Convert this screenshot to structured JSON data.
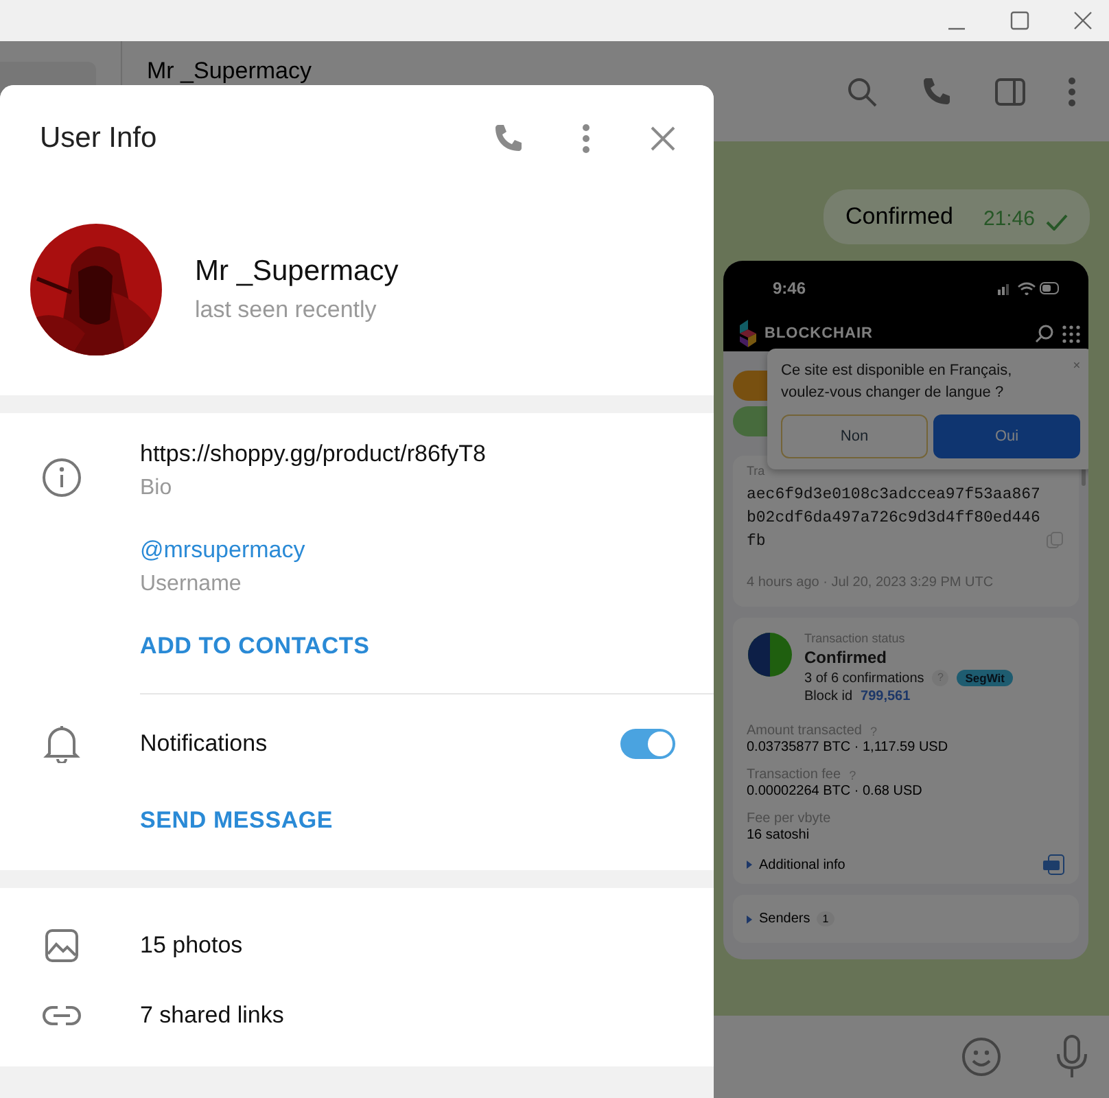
{
  "chat_header": {
    "title": "Mr _Supermacy"
  },
  "messages": [
    {
      "kind": "text",
      "text": "Confirmed",
      "time": "21:46",
      "read": true
    }
  ],
  "shared_screenshot": {
    "clock": "9:46",
    "brand": "BLOCKCHAIR",
    "popup": {
      "text": "Ce site est disponible en Français, voulez-vous changer de langue ?",
      "buttons": [
        {
          "label": "Non",
          "primary": false
        },
        {
          "label": "Oui",
          "primary": true
        }
      ]
    },
    "hash_label": "Tra",
    "hash": "aec6f9d3e0108c3adccea97f53aa867b02cdf6da497a726c9d3d4ff80ed446fb",
    "timestamp": "4 hours ago · Jul 20, 2023 3:29 PM UTC",
    "status_label": "Transaction status",
    "status": "Confirmed",
    "confirmations": "3 of 6 confirmations",
    "help": "?",
    "tag": "SegWit",
    "block_label": "Block id",
    "block": "799,561",
    "fields": [
      {
        "label": "Amount transacted",
        "help": "?",
        "value": "0.03735877 BTC · 1,117.59 USD"
      },
      {
        "label": "Transaction fee",
        "help": "?",
        "value": "0.00002264 BTC · 0.68 USD"
      },
      {
        "label": "Fee per vbyte",
        "value": "16 satoshi"
      }
    ],
    "expanders": [
      {
        "label": "Additional info",
        "pdf": true
      },
      {
        "label": "Senders",
        "count": "1"
      }
    ]
  },
  "user_info": {
    "title": "User Info",
    "name": "Mr _Supermacy",
    "status": "last seen recently",
    "bio": {
      "value": "https://shoppy.gg/product/r86fyT8",
      "label": "Bio"
    },
    "username": {
      "value": "@mrsupermacy",
      "label": "Username"
    },
    "add_contact": "ADD TO CONTACTS",
    "notifications": {
      "label": "Notifications",
      "on": true
    },
    "send_message": "SEND MESSAGE",
    "media": [
      {
        "kind": "photos",
        "label": "15 photos"
      },
      {
        "kind": "links",
        "label": "7 shared links"
      }
    ]
  }
}
